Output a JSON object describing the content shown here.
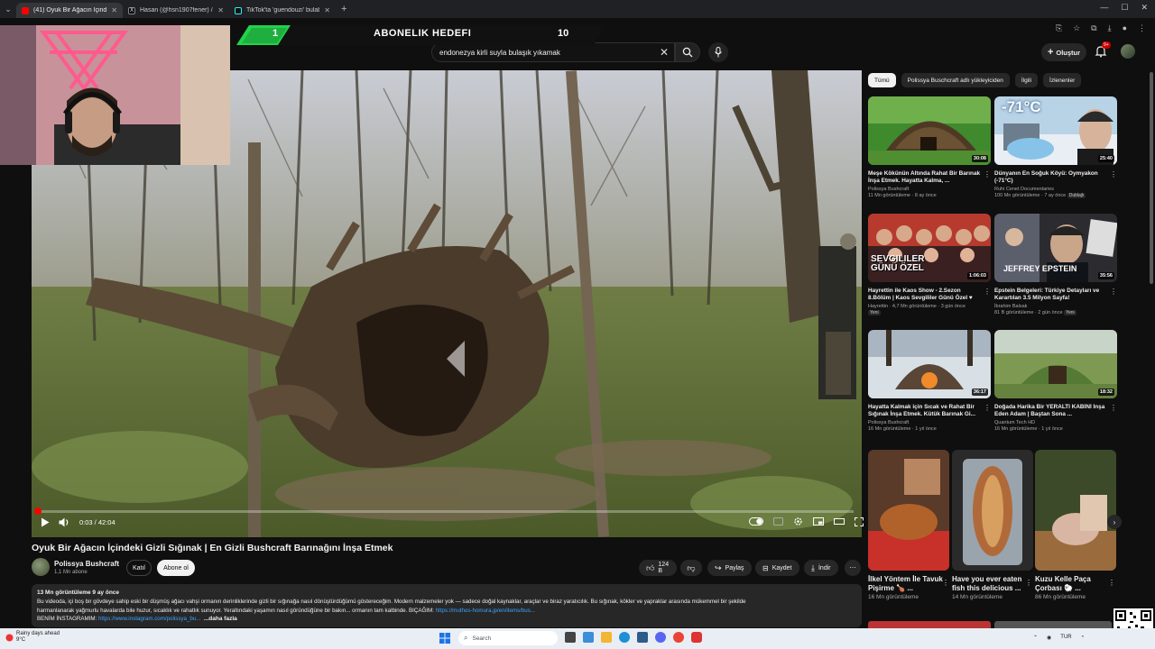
{
  "browser": {
    "tabs": [
      {
        "title": "(41) Oyuk Bir Ağacın İçindeki G",
        "active": true,
        "favicon_color": "#ff0000"
      },
      {
        "title": "Hasan (@hsn1907fener) / X",
        "active": false,
        "favicon_color": "#ffffff"
      },
      {
        "title": "TikTok'ta 'guendouzi' bulabilirs",
        "active": false,
        "favicon_color": "#ffffff"
      }
    ],
    "new_tab": "+"
  },
  "goal_overlay": {
    "title": "ABONELIK HEDEFI",
    "current": "1",
    "target": "10"
  },
  "header": {
    "search_value": "endonezya kirli suyla bulaşık yıkamak",
    "create_label": "Oluştur",
    "notif_count": "9+"
  },
  "player": {
    "time": "0:03 / 42:04",
    "progress_fraction": 0.0012
  },
  "video": {
    "title": "Oyuk Bir Ağacın İçindeki Gizli Sığınak | En Gizli Bushcraft Barınağını İnşa Etmek",
    "channel": "Polissya Bushcraft",
    "subscribers": "1,1 Mn abone",
    "join_label": "Katıl",
    "subscribe_label": "Abone ol",
    "likes": "124 B",
    "share_label": "Paylaş",
    "save_label": "Kaydet",
    "download_label": "İndir"
  },
  "description": {
    "stats": "13 Mn görüntüleme  9 ay önce",
    "line1": "Bu videoda, içi boş bir gövdeye sahip eski bir düşmüş ağacı vahşi ormanın derinliklerinde gizli bir sığınağa nasıl dönüştürdüğümü göstereceğim. Modern malzemeler yok — sadece doğal kaynaklar, araçlar ve biraz yaratıcılık. Bu sığınak, kökler ve yapraklar arasında mükemmel bir şekilde",
    "line2a": "harmanlanarak yağmurlu havalarda bile huzur, sıcaklık ve rahatlık sunuyor. Yeraltındaki yaşamın nasıl göründüğüne bir bakın... ormanın tam kalbinde. BIÇAĞIM: ",
    "line2_link": "https://muthos-homura.jp/en/items/bus...",
    "line3a": "BENİM İNSTAGRAMIM: ",
    "line3_link": "https://www.instagram.com/polissya_bu...",
    "more": "...daha fazla"
  },
  "chips": [
    {
      "label": "Tümü",
      "active": true
    },
    {
      "label": "Polissya Buschcraft adlı yükleyiciden",
      "active": false
    },
    {
      "label": "İlgili",
      "active": false
    },
    {
      "label": "İzlenenler",
      "active": false
    }
  ],
  "recommendations": [
    {
      "title": "Meşe Kökünün Altında Rahat Bir Barınak İnşa Etmek. Hayatta Kalma, ...",
      "channel": "Polissya Bushcraft",
      "meta": "11 Mn görüntüleme · 8 ay önce",
      "duration": "30:08",
      "badge": "",
      "thumb": "hut"
    },
    {
      "title": "Dünyanın En Soğuk Köyü: Oymyakon (-71°C)",
      "channel": "Ruhi Cenet Documentaries",
      "meta": "100 Mn görüntüleme · 7 ay önce",
      "duration": "25:40",
      "badge": "Dublajlı",
      "thumb": "cold",
      "overlay": "-71°C"
    },
    {
      "title": "Hayrettin ile Kaos Show - 2.Sezon 8.Bölüm | Kaos Sevgililer Günü Özel ♥",
      "channel": "Hayrettin",
      "meta": "4,7 Mn görüntüleme · 3 gün önce",
      "duration": "1:06:03",
      "badge": "Yeni",
      "thumb": "kaos",
      "overlay": "SEVGILILER GÜNÜ ÖZEL"
    },
    {
      "title": "Epstein Belgeleri: Türkiye Detayları ve Karartılan 3.5 Milyon Sayfa!",
      "channel": "İbrahim Balsak",
      "meta": "81 B görüntüleme · 2 gün önce",
      "duration": "35:56",
      "badge": "Yeni",
      "thumb": "epstein",
      "overlay": "JEFFREY EPSTEIN"
    },
    {
      "title": "Hayatta Kalmak için Sıcak ve Rahat Bir Sığınak İnşa Etmek. Kütük Barınak Gi...",
      "channel": "Polissya Bushcraft",
      "meta": "16 Mn görüntüleme · 1 yıl önce",
      "duration": "36:17",
      "badge": "",
      "thumb": "snow"
    },
    {
      "title": "Doğada Harika Bir YERALTI KABİNİ İnşa Eden Adam | Baştan Sona ...",
      "channel": "Quantum Tech HD",
      "meta": "16 Mn görüntüleme · 1 yıl önce",
      "duration": "18:32",
      "badge": "",
      "thumb": "cabin"
    }
  ],
  "shorts": [
    {
      "title": "İlkel Yöntem İle Tavuk Pişirme 🍗 ...",
      "views": "16 Mn görüntüleme"
    },
    {
      "title": "Have you ever eaten fish this delicious ...",
      "views": "14 Mn görüntüleme"
    },
    {
      "title": "Kuzu Kelle Paça Çorbası 🐑 ...",
      "views": "86 Mn görüntüleme"
    }
  ],
  "taskbar": {
    "weather_line1": "Rainy days ahead",
    "weather_line2": "9°C",
    "search_placeholder": "Search",
    "lang": "TUR"
  },
  "colors": {
    "accent": "#ff0000",
    "bg": "#0f0f0f",
    "surface": "#272727",
    "link": "#3ea6ff",
    "goal_green": "#21d34a"
  }
}
